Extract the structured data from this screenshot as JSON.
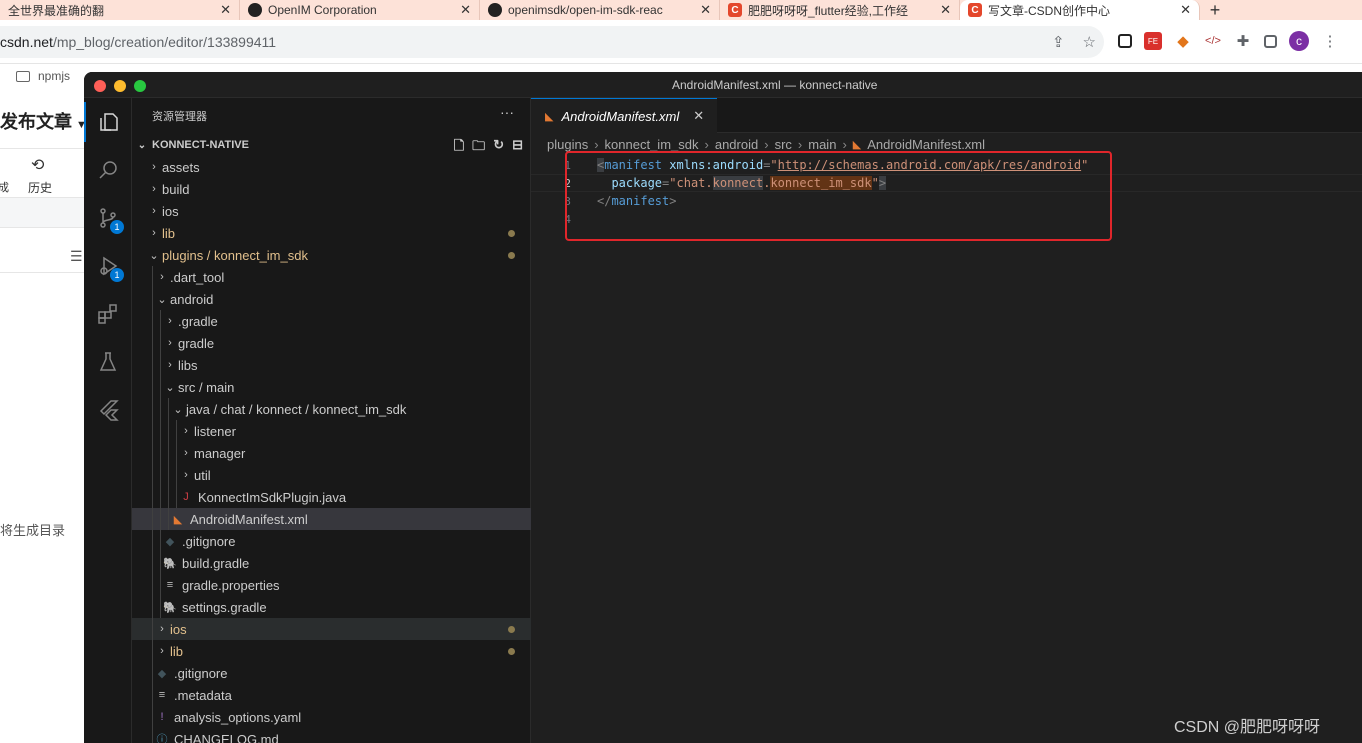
{
  "browser": {
    "tabs": [
      {
        "title": "全世界最准确的翻",
        "favicon": "doc-icon",
        "active": false
      },
      {
        "title": "OpenIM Corporation",
        "favicon": "github-icon",
        "active": false
      },
      {
        "title": "openimsdk/open-im-sdk-reac",
        "favicon": "github-icon",
        "active": false
      },
      {
        "title": "肥肥呀呀呀_flutter经验,工作经",
        "favicon": "csdn-icon",
        "active": false
      },
      {
        "title": "写文章-CSDN创作中心",
        "favicon": "csdn-icon",
        "active": true
      }
    ],
    "url_host": "csdn.net",
    "url_path": "/mp_blog/creation/editor/133899411",
    "profile_initial": "c",
    "bookmark": "npmjs"
  },
  "csdn": {
    "publish_title": "发布文章",
    "history_label": "历史",
    "left_tool_label": "成",
    "toc_hint": "将生成目录",
    "watermark": "CSDN @肥肥呀呀呀"
  },
  "vscode": {
    "window_title": "AndroidManifest.xml — konnect-native",
    "explorer_title": "资源管理器",
    "project_name": "KONNECT-NATIVE",
    "badges": {
      "scm": "1",
      "debug": "1"
    },
    "tree": [
      {
        "label": "assets",
        "type": "folder",
        "depth": 0,
        "expanded": false
      },
      {
        "label": "build",
        "type": "folder",
        "depth": 0,
        "expanded": false
      },
      {
        "label": "ios",
        "type": "folder",
        "depth": 0,
        "expanded": false
      },
      {
        "label": "lib",
        "type": "folder",
        "depth": 0,
        "expanded": false,
        "modified": true
      },
      {
        "label": "plugins / konnect_im_sdk",
        "type": "folder",
        "depth": 0,
        "expanded": true,
        "modified": true
      },
      {
        "label": ".dart_tool",
        "type": "folder",
        "depth": 1,
        "expanded": false
      },
      {
        "label": "android",
        "type": "folder",
        "depth": 1,
        "expanded": true
      },
      {
        "label": ".gradle",
        "type": "folder",
        "depth": 2,
        "expanded": false
      },
      {
        "label": "gradle",
        "type": "folder",
        "depth": 2,
        "expanded": false
      },
      {
        "label": "libs",
        "type": "folder",
        "depth": 2,
        "expanded": false
      },
      {
        "label": "src / main",
        "type": "folder",
        "depth": 2,
        "expanded": true
      },
      {
        "label": "java / chat / konnect / konnect_im_sdk",
        "type": "folder",
        "depth": 3,
        "expanded": true
      },
      {
        "label": "listener",
        "type": "folder",
        "depth": 4,
        "expanded": false
      },
      {
        "label": "manager",
        "type": "folder",
        "depth": 4,
        "expanded": false
      },
      {
        "label": "util",
        "type": "folder",
        "depth": 4,
        "expanded": false
      },
      {
        "label": "KonnectImSdkPlugin.java",
        "type": "java",
        "depth": 4
      },
      {
        "label": "AndroidManifest.xml",
        "type": "xml",
        "depth": 3,
        "selected": true
      },
      {
        "label": ".gitignore",
        "type": "git",
        "depth": 2
      },
      {
        "label": "build.gradle",
        "type": "gradle",
        "depth": 2
      },
      {
        "label": "gradle.properties",
        "type": "props",
        "depth": 2
      },
      {
        "label": "settings.gradle",
        "type": "gradle",
        "depth": 2
      },
      {
        "label": "ios",
        "type": "folder",
        "depth": 1,
        "expanded": false,
        "modified": true,
        "hover": true
      },
      {
        "label": "lib",
        "type": "folder",
        "depth": 1,
        "expanded": false,
        "modified": true
      },
      {
        "label": ".gitignore",
        "type": "git",
        "depth": 1
      },
      {
        "label": ".metadata",
        "type": "props",
        "depth": 1
      },
      {
        "label": "analysis_options.yaml",
        "type": "yaml",
        "depth": 1
      },
      {
        "label": "CHANGELOG.md",
        "type": "md",
        "depth": 1
      }
    ],
    "editor_tab": "AndroidManifest.xml",
    "breadcrumbs": [
      "plugins",
      "konnect_im_sdk",
      "android",
      "src",
      "main",
      "AndroidManifest.xml"
    ],
    "code": {
      "line_numbers": [
        "1",
        "2",
        "3",
        "4"
      ],
      "l1": {
        "open": "<",
        "tag": "manifest",
        "attr": "xmlns:android",
        "eq": "=",
        "q1": "\"",
        "url": "http://schemas.android.com/apk/res/android",
        "q2": "\""
      },
      "l2": {
        "attr": "package",
        "eq": "=",
        "q1": "\"",
        "s1": "chat.",
        "s2": "ko",
        "s3": "nnect",
        "s4": ".",
        "s5": "konnect_im_sdk",
        "q2": "\"",
        "close": ">"
      },
      "l3": {
        "open": "</",
        "tag": "manifest",
        "close": ">"
      }
    }
  }
}
